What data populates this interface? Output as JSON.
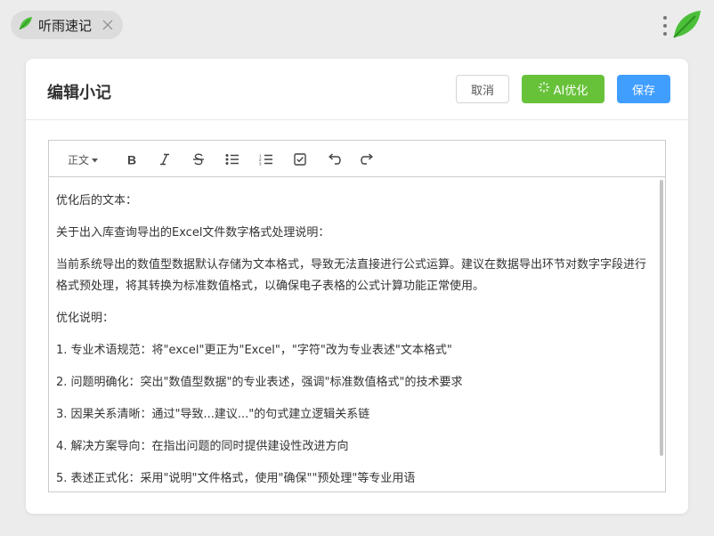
{
  "app": {
    "tab_title": "听雨速记"
  },
  "card": {
    "title": "编辑小记",
    "cancel_label": "取消",
    "ai_label": "AI优化",
    "save_label": "保存"
  },
  "toolbar": {
    "style_label": "正文",
    "tools": [
      "bold-icon",
      "italic-icon",
      "strikethrough-icon",
      "bullet-list-icon",
      "numbered-list-icon",
      "checklist-icon",
      "undo-icon",
      "redo-icon"
    ]
  },
  "content": {
    "paragraphs": [
      "优化后的文本：",
      "关于出入库查询导出的Excel文件数字格式处理说明：",
      "当前系统导出的数值型数据默认存储为文本格式，导致无法直接进行公式运算。建议在数据导出环节对数字字段进行格式预处理，将其转换为标准数值格式，以确保电子表格的公式计算功能正常使用。",
      "优化说明：",
      "1. 专业术语规范：将\"excel\"更正为\"Excel\"，\"字符\"改为专业表述\"文本格式\"",
      "2. 问题明确化：突出\"数值型数据\"的专业表述，强调\"标准数值格式\"的技术要求",
      "3. 因果关系清晰：通过\"导致...建议...\"的句式建立逻辑关系链",
      "4. 解决方案导向：在指出问题的同时提供建设性改进方向",
      "5. 表述正式化：采用\"说明\"文件格式，使用\"确保\"\"预处理\"等专业用语"
    ]
  },
  "colors": {
    "ai_button": "#67c23a",
    "save_button": "#409eff",
    "brand_green": "#4cbf3a"
  }
}
